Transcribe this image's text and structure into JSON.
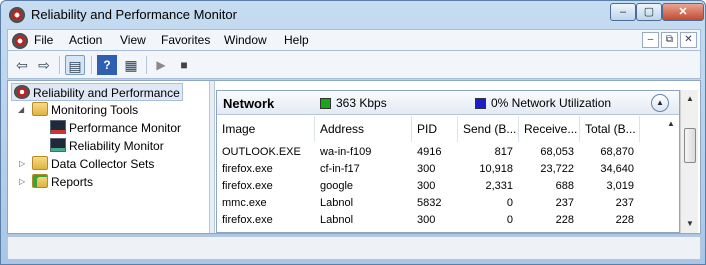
{
  "window": {
    "title": "Reliability and Performance Monitor",
    "minimize": "–",
    "maximize": "▢",
    "close": "✕"
  },
  "menu": {
    "items": [
      "File",
      "Action",
      "View",
      "Favorites",
      "Window",
      "Help"
    ],
    "mdi_minimize": "–",
    "mdi_restore": "⧉",
    "mdi_close": "✕"
  },
  "toolbar": {
    "back_icon": "⇦",
    "forward_icon": "⇨",
    "pane_icon": "▤",
    "help_icon": "?",
    "props_icon": "▦",
    "play_icon": "▶",
    "stop_icon": "■"
  },
  "tree": {
    "root": "Reliability and Performance",
    "monitoring_tools": "Monitoring Tools",
    "performance_monitor": "Performance Monitor",
    "reliability_monitor": "Reliability Monitor",
    "data_collector_sets": "Data Collector Sets",
    "reports": "Reports"
  },
  "network_panel": {
    "title": "Network",
    "bandwidth_label": "363 Kbps",
    "bandwidth_color": "#1aa51a",
    "utilization_label": "0% Network Utilization",
    "utilization_color": "#1c1ccc",
    "collapse_icon": "▲",
    "columns": [
      "Image",
      "Address",
      "PID",
      "Send (B...",
      "Receive...",
      "Total (B..."
    ],
    "rows": [
      [
        "OUTLOOK.EXE",
        "wa-in-f109",
        "4916",
        "817",
        "68,053",
        "68,870"
      ],
      [
        "firefox.exe",
        "cf-in-f17",
        "300",
        "10,918",
        "23,722",
        "34,640"
      ],
      [
        "firefox.exe",
        "google",
        "300",
        "2,331",
        "688",
        "3,019"
      ],
      [
        "mmc.exe",
        "Labnol",
        "5832",
        "0",
        "237",
        "237"
      ],
      [
        "firefox.exe",
        "Labnol",
        "300",
        "0",
        "228",
        "228"
      ]
    ]
  },
  "scrollbar": {
    "up": "▲",
    "down": "▼"
  }
}
